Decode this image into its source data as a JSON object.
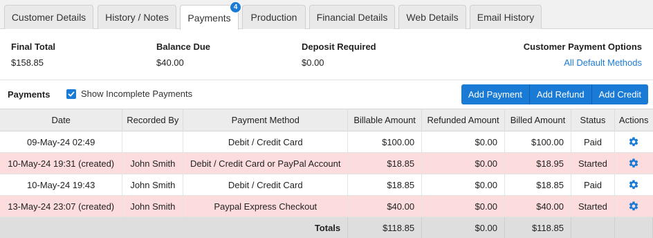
{
  "tabs": [
    {
      "label": "Customer Details"
    },
    {
      "label": "History / Notes"
    },
    {
      "label": "Payments",
      "badge": "4"
    },
    {
      "label": "Production"
    },
    {
      "label": "Financial Details"
    },
    {
      "label": "Web Details"
    },
    {
      "label": "Email History"
    }
  ],
  "summary": {
    "final_total_label": "Final Total",
    "final_total_value": "$158.85",
    "balance_due_label": "Balance Due",
    "balance_due_value": "$40.00",
    "deposit_label": "Deposit Required",
    "deposit_value": "$0.00",
    "options_label": "Customer Payment Options",
    "options_link": "All Default Methods"
  },
  "payments_bar": {
    "title": "Payments",
    "checkbox_label": "Show Incomplete Payments",
    "add_payment": "Add Payment",
    "add_refund": "Add Refund",
    "add_credit": "Add Credit"
  },
  "table": {
    "headers": [
      "Date",
      "Recorded By",
      "Payment Method",
      "Billable Amount",
      "Refunded Amount",
      "Billed Amount",
      "Status",
      "Actions"
    ],
    "rows": [
      {
        "date": "09-May-24 02:49",
        "recorded_by": "",
        "method": "Debit / Credit Card",
        "billable": "$100.00",
        "refunded": "$0.00",
        "billed": "$100.00",
        "status": "Paid"
      },
      {
        "date": "10-May-24 19:31 (created)",
        "recorded_by": "John Smith",
        "method": "Debit / Credit Card or PayPal Account",
        "billable": "$18.85",
        "refunded": "$0.00",
        "billed": "$18.95",
        "status": "Started"
      },
      {
        "date": "10-May-24 19:43",
        "recorded_by": "John Smith",
        "method": "Debit / Credit Card",
        "billable": "$18.85",
        "refunded": "$0.00",
        "billed": "$18.85",
        "status": "Paid"
      },
      {
        "date": "13-May-24 23:07 (created)",
        "recorded_by": "John Smith",
        "method": "Paypal Express Checkout",
        "billable": "$40.00",
        "refunded": "$0.00",
        "billed": "$40.00",
        "status": "Started"
      }
    ],
    "totals": {
      "label": "Totals",
      "billable": "$118.85",
      "refunded": "$0.00",
      "billed": "$118.85"
    }
  },
  "colors": {
    "accent": "#1a7bd6",
    "row_incomplete": "#fcdcdc",
    "totals_bg": "#dedede"
  }
}
